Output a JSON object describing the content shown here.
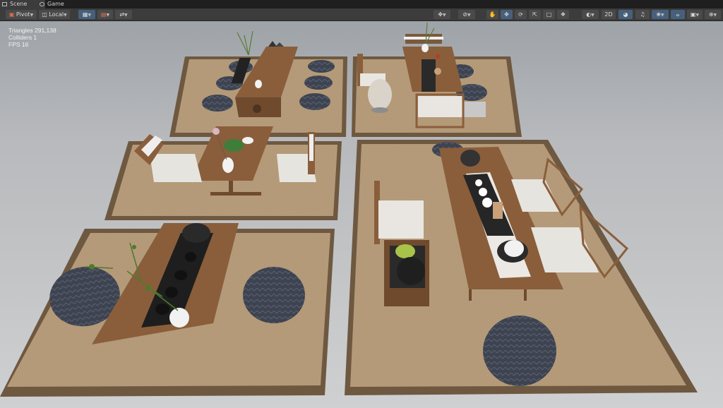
{
  "tabs": [
    {
      "label": "Scene",
      "icon": "grid-icon",
      "active": true
    },
    {
      "label": "Game",
      "icon": "gamepad-icon",
      "active": false
    }
  ],
  "toolbar": {
    "pivot_label": "Pivot",
    "local_label": "Local",
    "mode_2d_label": "2D",
    "accent": "#46607c"
  },
  "stats": {
    "triangles": "Triangles 291,138",
    "colliders": "Colliders 1",
    "fps": "FPS 16"
  },
  "scene_colors": {
    "background": "#c4c5c7",
    "rug": "#b79d7c",
    "rug_border": "#6e5840",
    "wood": "#8a5e3b",
    "cushion_dark": "#3d4350",
    "cushion_light": "#e6e4df"
  }
}
